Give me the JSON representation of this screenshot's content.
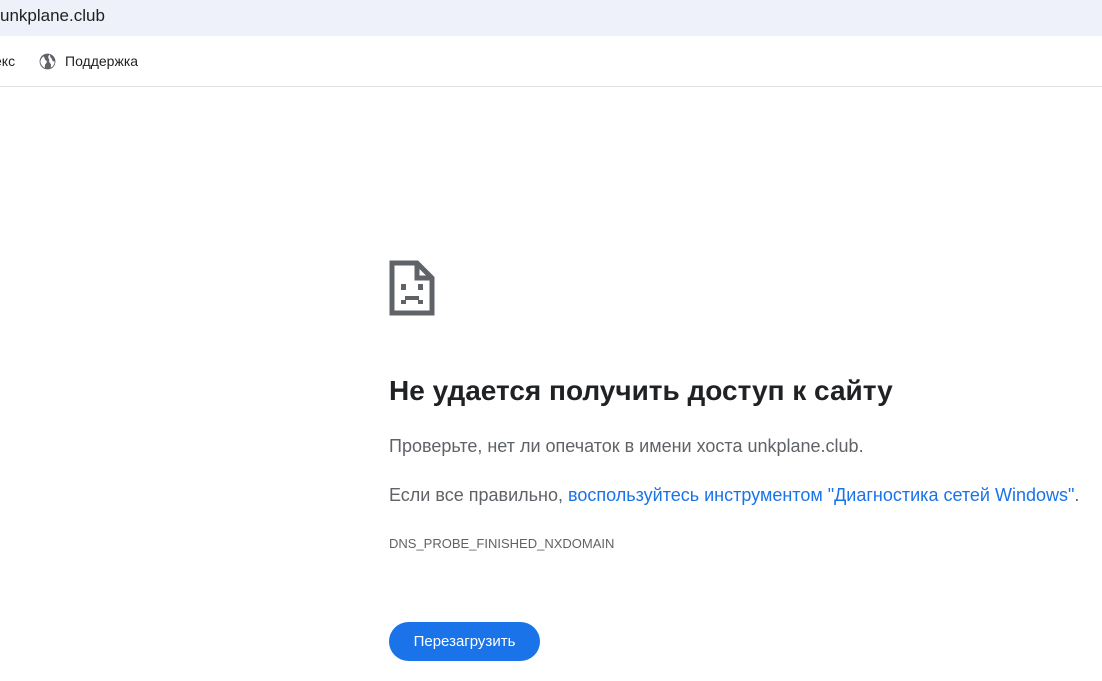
{
  "address_bar": {
    "url": "unkplane.club"
  },
  "bookmarks": [
    {
      "label": "екс",
      "icon": "none"
    },
    {
      "label": "Поддержка",
      "icon": "globe-icon"
    }
  ],
  "error": {
    "icon": "sad-file-icon",
    "title": "Не удается получить доступ к сайту",
    "hint": "Проверьте, нет ли опечаток в имени хоста unkplane.club.",
    "advice_prefix": "Если все правильно, ",
    "advice_link": "воспользуйтесь инструментом \"Диагностика сетей Windows\"",
    "advice_suffix": ".",
    "code": "DNS_PROBE_FINISHED_NXDOMAIN",
    "reload_label": "Перезагрузить"
  },
  "colors": {
    "accent": "#1a73e8",
    "text_primary": "#202124",
    "text_secondary": "#5f6368",
    "address_bar_bg": "#eef1fa"
  }
}
